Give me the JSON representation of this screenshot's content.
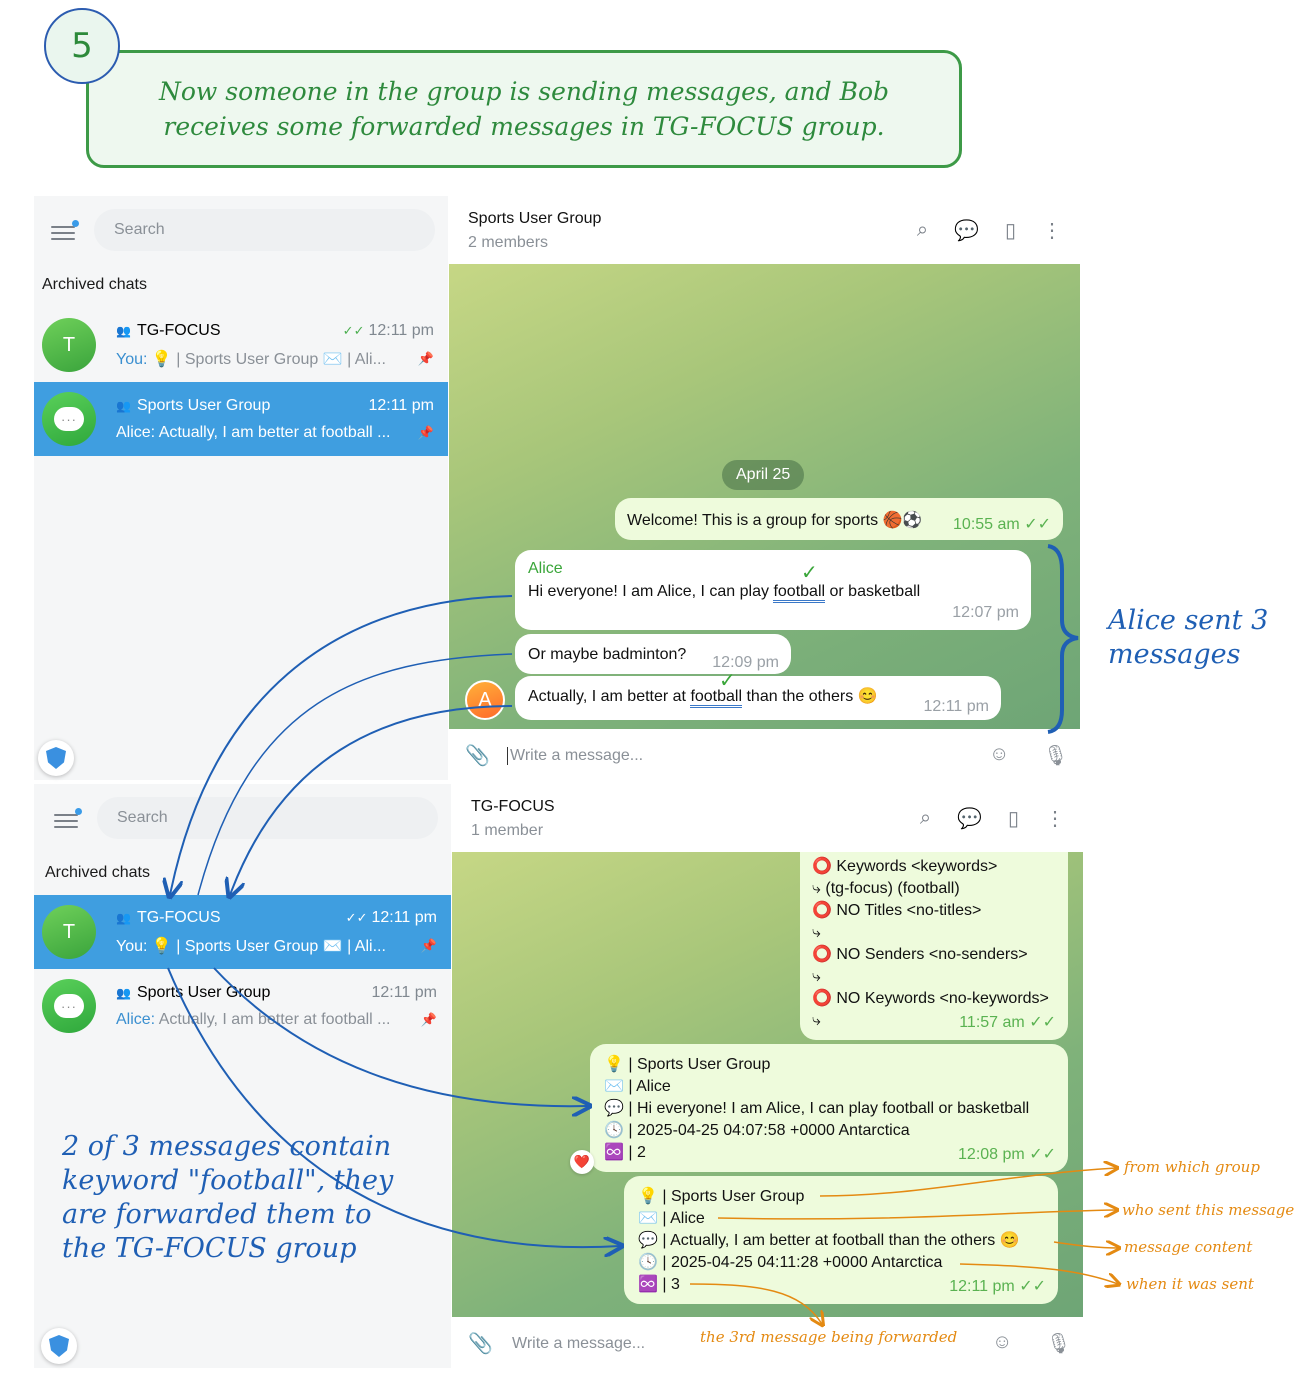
{
  "step": {
    "number": "5",
    "caption": "Now someone in the group is sending messages, and Bob receives some forwarded messages in TG-FOCUS group."
  },
  "top": {
    "left": {
      "search_placeholder": "Search",
      "archived_label": "Archived chats",
      "chats": [
        {
          "title": "TG-FOCUS",
          "time": "12:11 pm",
          "you": "You:",
          "preview": "💡 | Sports User Group ✉️ | Ali...",
          "selected": false
        },
        {
          "title": "Sports User Group",
          "time": "12:11 pm",
          "you": "",
          "preview": "Alice: Actually, I am better at football ...",
          "selected": true
        }
      ]
    },
    "chat": {
      "title": "Sports User Group",
      "subtitle": "2 members",
      "date_pill": "April 25",
      "welcome": {
        "text": "Welcome! This is a group for sports 🏀⚽",
        "time": "10:55 am"
      },
      "alice_msgs": [
        {
          "sender": "Alice",
          "pre": "Hi everyone! I am Alice, I can play ",
          "keyword": "football",
          "post": " or basketball",
          "time": "12:07 pm"
        },
        {
          "text": "Or maybe badminton?",
          "time": "12:09 pm"
        },
        {
          "pre": "Actually, I am better at ",
          "keyword": "football",
          "post": " than the others 😊",
          "time": "12:11 pm"
        }
      ],
      "avatar_letter": "A",
      "composer_placeholder": "Write a message..."
    }
  },
  "bottom": {
    "left": {
      "search_placeholder": "Search",
      "archived_label": "Archived chats",
      "chats": [
        {
          "title": "TG-FOCUS",
          "time": "12:11 pm",
          "you": "You:",
          "preview": "💡 | Sports User Group ✉️ | Ali...",
          "selected": true
        },
        {
          "title": "Sports User Group",
          "time": "12:11 pm",
          "you": "Alice:",
          "preview": "Actually, I am better at football ...",
          "selected": false
        }
      ]
    },
    "chat": {
      "title": "TG-FOCUS",
      "subtitle": "1 member",
      "config_lines": [
        "⭕ Keywords <keywords>",
        "⤷ (tg-focus)  (football)",
        "⭕ NO Titles <no-titles>",
        "⤷",
        "⭕ NO Senders <no-senders>",
        "⤷",
        "⭕ NO Keywords <no-keywords>",
        "⤷"
      ],
      "config_time": "11:57 am",
      "forward1": {
        "lines": [
          "💡 | Sports User Group",
          "✉️ | Alice",
          "💬 | Hi everyone! I am Alice, I can play football or basketball",
          "🕓 | 2025-04-25 04:07:58 +0000 Antarctica",
          "♾️ | 2"
        ],
        "time": "12:08 pm",
        "reaction": "❤️"
      },
      "forward2": {
        "lines": [
          "💡 | Sports User Group",
          "✉️ | Alice",
          "💬 | Actually, I am better at football than the others 😊",
          "🕓 | 2025-04-25 04:11:28 +0000 Antarctica",
          "♾️ | 3"
        ],
        "time": "12:11 pm"
      },
      "composer_placeholder": "Write a message..."
    }
  },
  "annotations": {
    "alice_sent": "Alice sent 3 messages",
    "keyword_note": "2 of 3 messages contain keyword \"football\", they are forwarded them to the TG-FOCUS group",
    "from_which_group": "from which group",
    "who_sent": "who sent this message",
    "message_content": "message content",
    "when_sent": "when it was sent",
    "third_forwarded": "the 3rd message being forwarded"
  },
  "colors": {
    "selected_chat": "#3f9ee0",
    "green_accent": "#3aa63a",
    "annotation_blue": "#1f5fb4",
    "annotation_orange": "#e48a12"
  }
}
